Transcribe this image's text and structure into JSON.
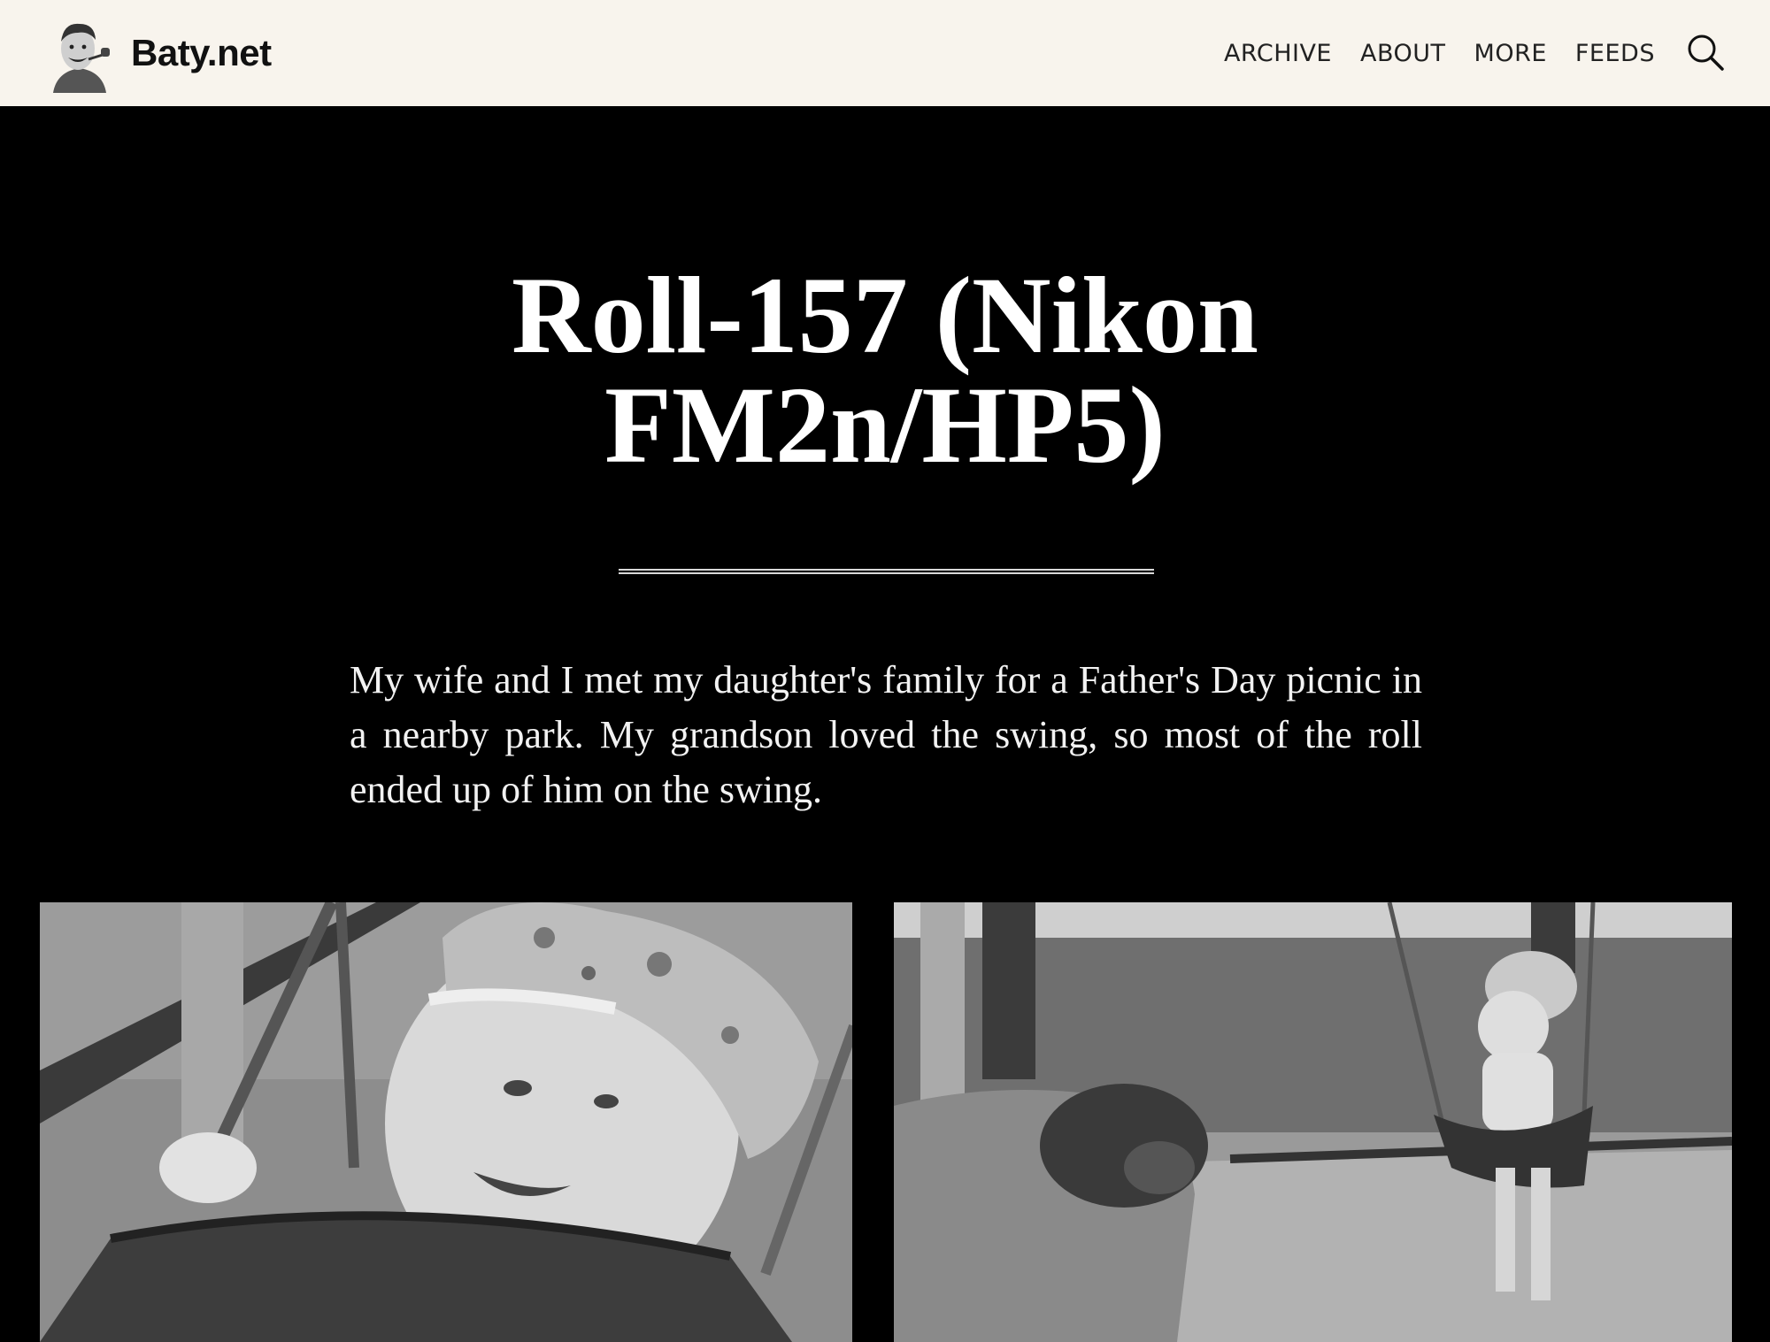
{
  "header": {
    "site_name": "Baty.net",
    "logo_icon": "portrait-logo-icon",
    "background_color": "#f8f4ed",
    "nav": [
      {
        "label": "ARCHIVE"
      },
      {
        "label": "ABOUT"
      },
      {
        "label": "MORE"
      },
      {
        "label": "FEEDS"
      }
    ],
    "search_icon": "search-icon"
  },
  "post": {
    "title": "Roll-157 (Nikon FM2n/HP5)",
    "intro": "My wife and I met my daughter's family for a Father's Day picnic in a nearby park. My grandson loved the swing, so most of the roll ended up of him on the swing."
  },
  "photos": [
    {
      "icon": "baby-on-swing-closeup-photo"
    },
    {
      "icon": "man-pushing-baby-swing-photo"
    }
  ],
  "colors": {
    "page_background": "#000000",
    "text": "#ffffff"
  }
}
